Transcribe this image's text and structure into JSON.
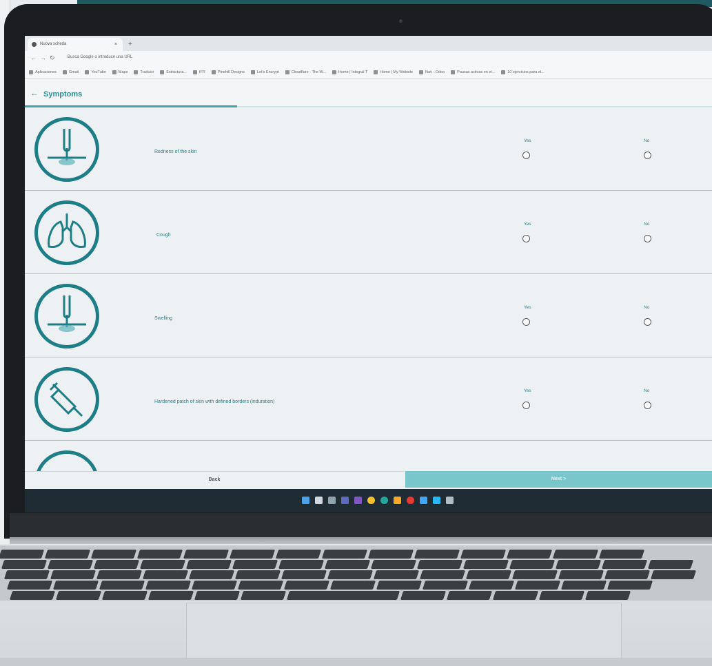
{
  "browser": {
    "tab_title": "Nuova scheda",
    "tab_close": "×",
    "new_tab": "+",
    "url_placeholder": "Busca Google o introduce una URL",
    "bookmarks": [
      "Aplicaciones",
      "Gmail",
      "YouTube",
      "Maps",
      "Traducir",
      "Estructura...",
      "IFR",
      "Pinehill Designs",
      "Let's Encrypt",
      "Cloudflare - The W...",
      "Home | Integral T",
      "Home | My Website",
      "Nav - Odoo",
      "Pausas activas en el...",
      "10 ejercicios para el..."
    ]
  },
  "app": {
    "back_arrow": "←",
    "title": "Symptoms",
    "yes_label": "Yes",
    "no_label": "No",
    "symptoms": [
      {
        "label": "Redness of the skin",
        "icon": "skin-injection-icon"
      },
      {
        "label": "Cough",
        "icon": "lungs-icon"
      },
      {
        "label": "Swelling",
        "icon": "skin-injection-icon"
      },
      {
        "label": "Hardened patch of skin with defined borders (induration)",
        "icon": "syringe-icon"
      }
    ],
    "back_button": "Back",
    "next_button": "Next >"
  },
  "colors": {
    "accent": "#1e7e87",
    "next_button": "#79c7cb"
  }
}
